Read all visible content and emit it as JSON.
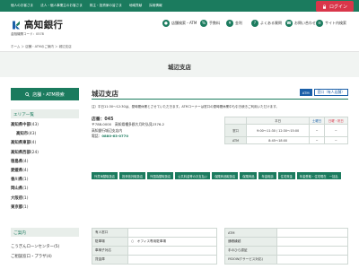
{
  "topnav": {
    "items": [
      "個人のお客さま",
      "法人・個人事業主のお客さま",
      "株主・投資家の皆さま",
      "地域貢献",
      "採用情報"
    ],
    "login_label": "ログイン"
  },
  "header": {
    "bank_name": "高知銀行",
    "bank_code": "金融機関コード：0578",
    "nav": [
      {
        "icon": "map-pin-icon",
        "label": "店舗検索・ATM"
      },
      {
        "icon": "percent-icon",
        "label": "手数料"
      },
      {
        "icon": "yen-icon",
        "label": "金利"
      },
      {
        "icon": "question-icon",
        "label": "よくある質問"
      },
      {
        "icon": "phone-icon",
        "label": "お問い合わせ"
      },
      {
        "icon": "sitemap-icon",
        "label": "サイト内検索"
      }
    ]
  },
  "breadcrumb": "ホーム ＞ 店舗・ATMのご案内 ＞ 城辺支店",
  "page_title": "城辺支店",
  "sidebar": {
    "search_label": "店舗・ATM検索",
    "area_title": "エリア一覧",
    "areas": [
      {
        "name": "高知県中部",
        "count": "(43)"
      },
      {
        "name": "高知市",
        "count": "(43)"
      },
      {
        "name": "高知県東部",
        "count": "(4)"
      },
      {
        "name": "高知県西部",
        "count": "(24)"
      },
      {
        "name": "徳島県",
        "count": "(4)"
      },
      {
        "name": "愛媛県",
        "count": "(4)"
      },
      {
        "name": "香川県",
        "count": "(1)"
      },
      {
        "name": "岡山県",
        "count": "(1)"
      },
      {
        "name": "大阪府",
        "count": "(1)"
      },
      {
        "name": "東京都",
        "count": "(1)"
      }
    ],
    "other_title": "ご案内",
    "others": [
      "こうぎんローンセンター(5)",
      "ご相談窓口・プラザ(4)"
    ]
  },
  "branch": {
    "name": "城辺支店",
    "badge_atm": "ATM",
    "badge_window": "窓口（有人店舗）",
    "notice": "注）平日11:30～12:30は、昼時間休業とさせていただきます。ATMコーナーは窓口の昼時間休業中も引き続きご利用いただけます。",
    "code": "店番：045",
    "address1": "〒788-0000　高知県幡多郡大月町弘見2376-2",
    "address2": "高知銀行城辺支店内",
    "tel_prefix": "電話：",
    "tel": "0880-63-0770"
  },
  "hours": {
    "headers": [
      "",
      "平日",
      "土曜日",
      "日曜・祝日"
    ],
    "rows": [
      {
        "label": "窓口",
        "weekday": "9:00～11:30 / 12:30～15:00",
        "sat": "−",
        "sun": "−"
      },
      {
        "label": "ATM",
        "weekday": "8:45～18:00",
        "sat": "−",
        "sun": "−"
      }
    ]
  },
  "services": [
    "外貨両替取扱店",
    "投資信託取扱店",
    "外国為替取扱店",
    "公共料金等のお支払い",
    "保険商品取扱店",
    "保険商品",
    "年金相談",
    "住宅資金",
    "年金受取・住宅現在　一括払"
  ],
  "detail_left": [
    {
      "label": "有人窓口",
      "value": ""
    },
    {
      "label": "駐車場",
      "value": "○　オフィス専用駐車場"
    },
    {
      "label": "車椅子対応",
      "value": ""
    },
    {
      "label": "貸金庫",
      "value": ""
    },
    {
      "label": "両替機",
      "value": ""
    }
  ],
  "detail_right": [
    {
      "label": "ATM",
      "value": ""
    },
    {
      "label": "通帳繰越",
      "value": ""
    },
    {
      "label": "(平日9:00～17:00)",
      "value": ""
    },
    {
      "label": "手のひら認証",
      "value": ""
    },
    {
      "label": "IYDOW(Tサービス対応)",
      "value": ""
    },
    {
      "label": "視覚障害者対応",
      "value": ""
    }
  ],
  "colors": {
    "brand_green": "#1b7b5e",
    "login_red": "#d9364a",
    "badge_blue": "#1a5fa8"
  }
}
